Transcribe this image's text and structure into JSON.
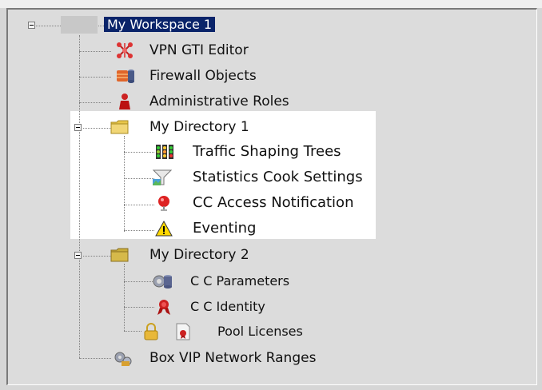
{
  "tree": {
    "root": {
      "label": "My Workspace 1",
      "icon": "workspace-icon"
    },
    "items": [
      {
        "label": "VPN GTI Editor",
        "icon": "vpn-editor-icon"
      },
      {
        "label": "Firewall Objects",
        "icon": "firewall-objects-icon"
      },
      {
        "label": "Administrative Roles",
        "icon": "admin-roles-icon"
      },
      {
        "label": "My Directory 1",
        "icon": "folder-icon",
        "expanded": true,
        "children": [
          {
            "label": "Traffic Shaping Trees",
            "icon": "traffic-light-icon"
          },
          {
            "label": "Statistics Cook Settings",
            "icon": "funnel-icon"
          },
          {
            "label": "CC Access Notification",
            "icon": "notification-icon"
          },
          {
            "label": "Eventing",
            "icon": "warning-icon"
          }
        ]
      },
      {
        "label": "My Directory 2",
        "icon": "folder-icon",
        "expanded": true,
        "children": [
          {
            "label": "C C Parameters",
            "icon": "parameters-icon"
          },
          {
            "label": "C C Identity",
            "icon": "identity-ribbon-icon"
          },
          {
            "label": "Pool Licenses",
            "icon": "license-icon"
          }
        ]
      },
      {
        "label": "Box VIP Network Ranges",
        "icon": "network-ranges-icon"
      }
    ]
  },
  "colors": {
    "selection": "#0a246a",
    "panel_bg": "#dcdcdc",
    "highlight_bg": "#ffffff",
    "folder": "#e8c64a"
  }
}
